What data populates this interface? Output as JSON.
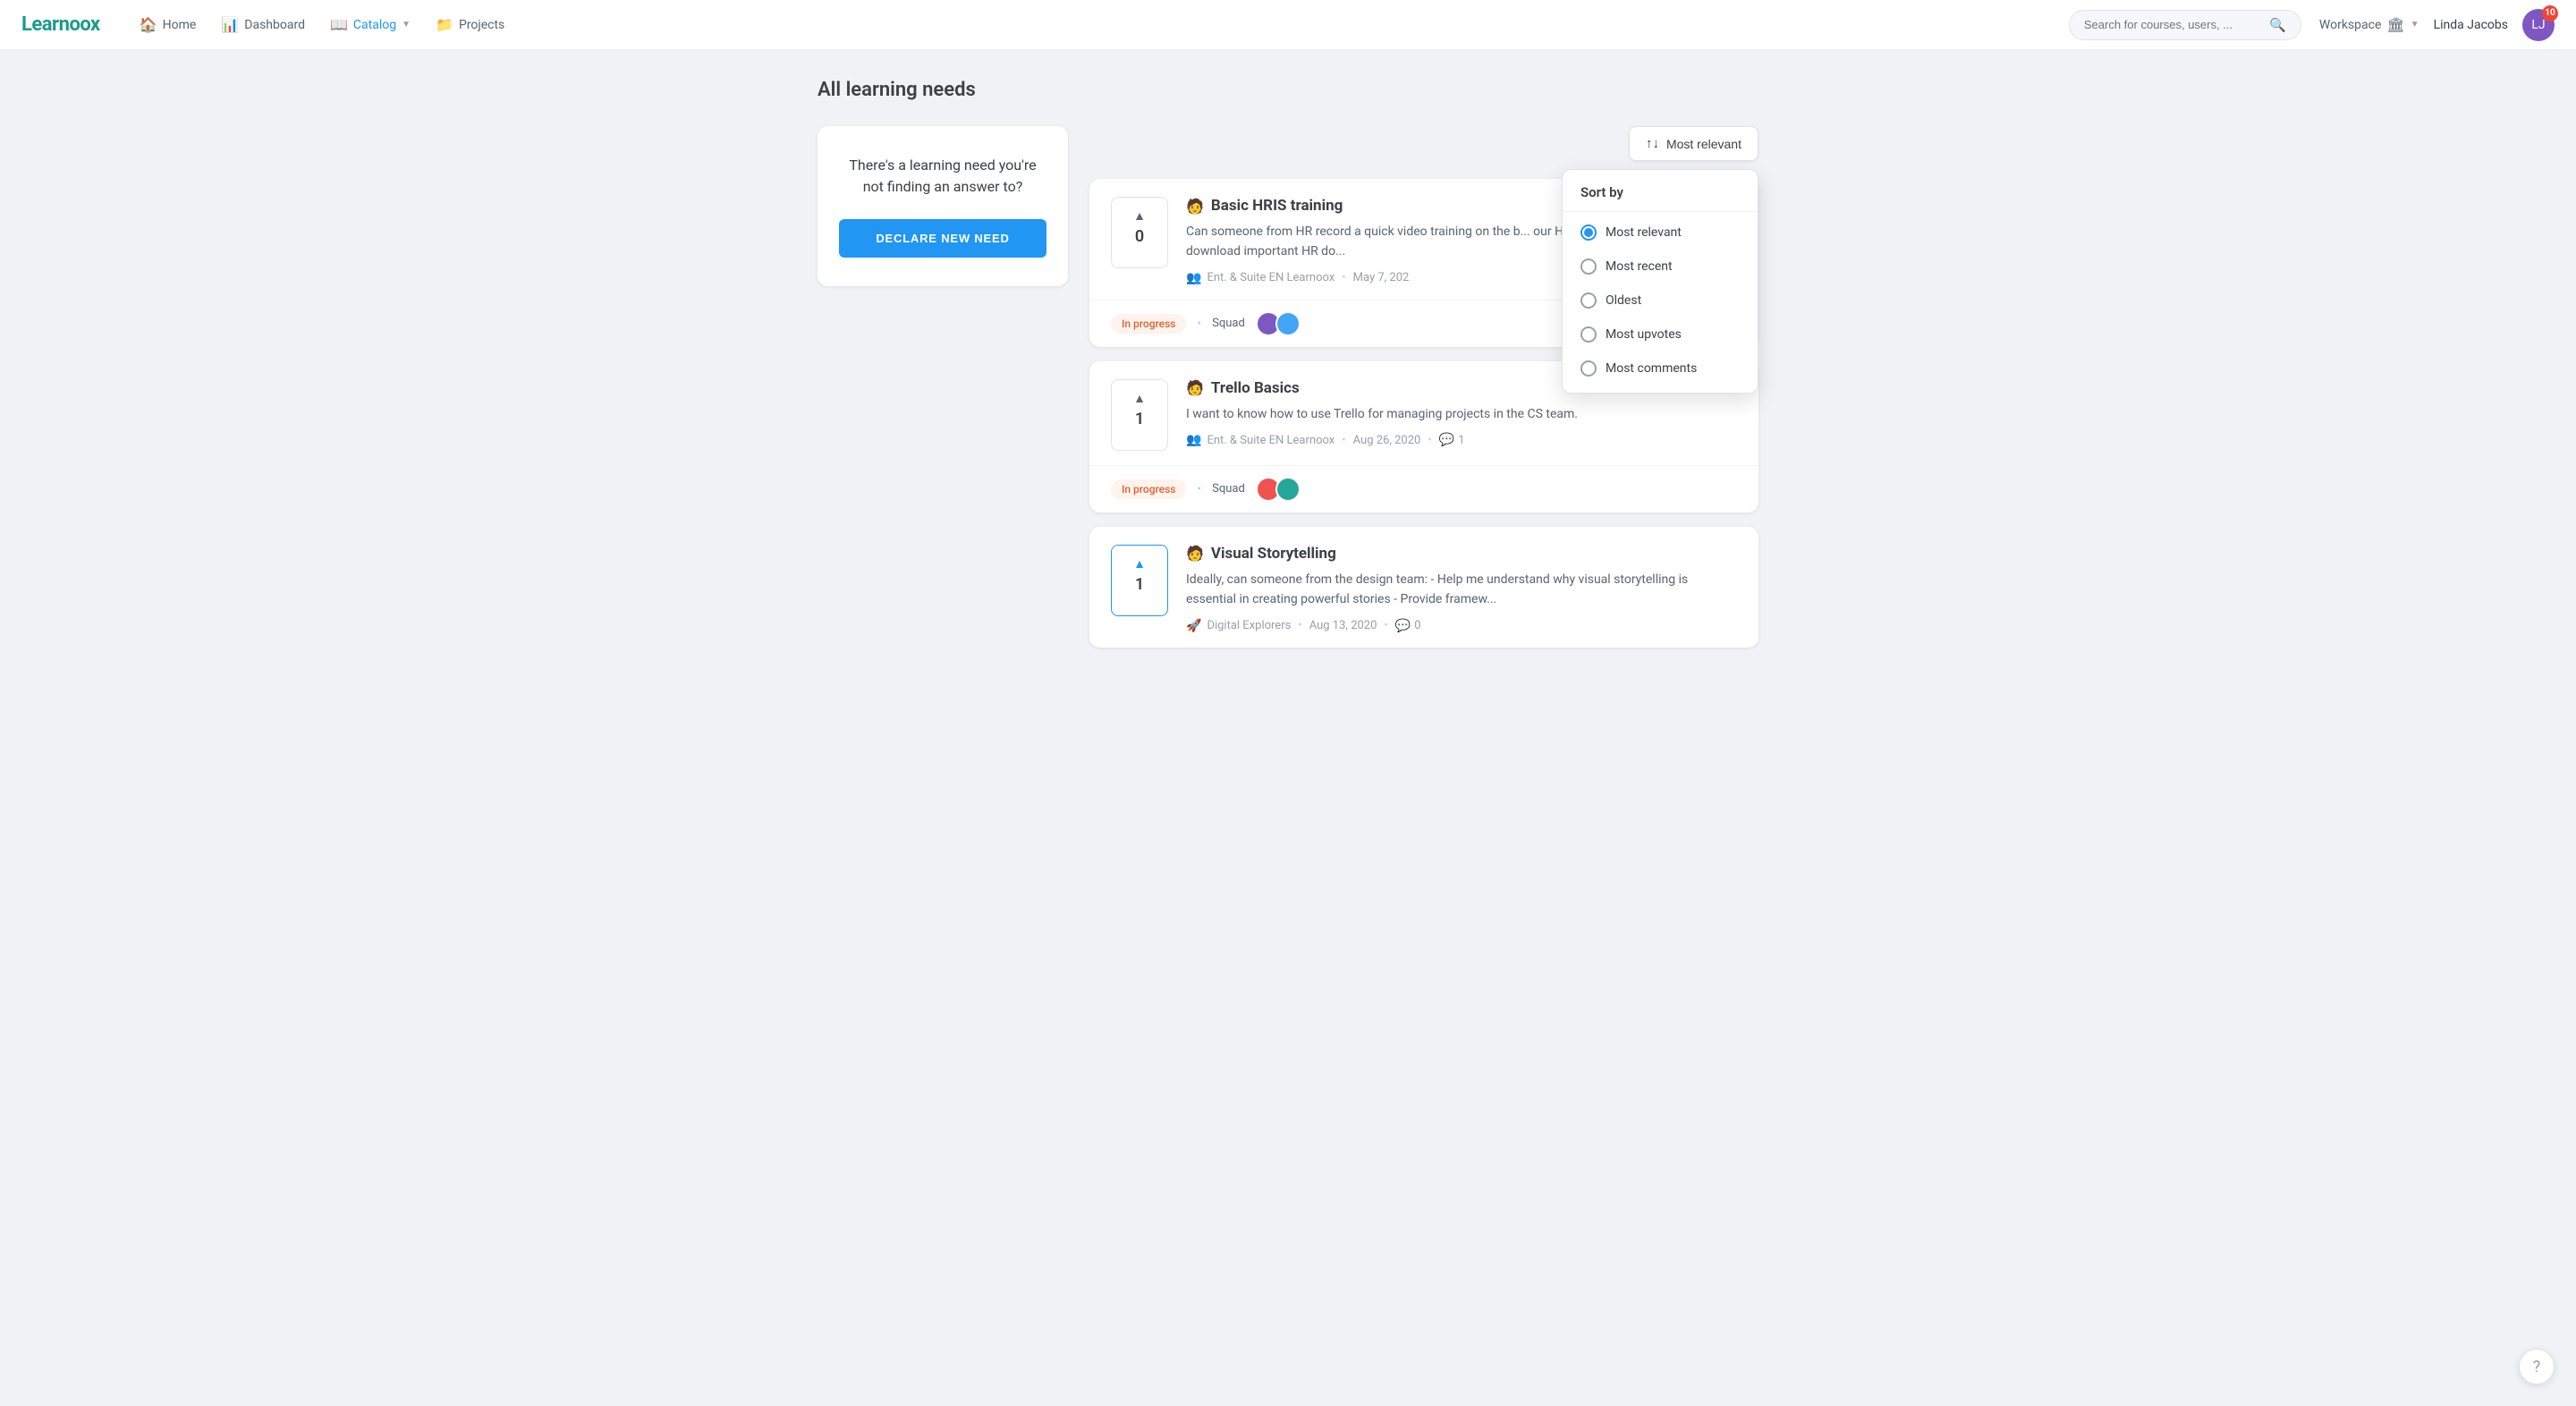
{
  "brand": {
    "logo": "Learnoox"
  },
  "nav": {
    "links": [
      {
        "id": "home",
        "icon": "🏠",
        "label": "Home",
        "active": false
      },
      {
        "id": "dashboard",
        "icon": "📊",
        "label": "Dashboard",
        "active": false
      },
      {
        "id": "catalog",
        "icon": "📖",
        "label": "Catalog",
        "active": true,
        "chevron": true
      },
      {
        "id": "projects",
        "icon": "📁",
        "label": "Projects",
        "active": false
      }
    ],
    "search_placeholder": "Search for courses, users, ...",
    "workspace_label": "Workspace",
    "user_name": "Linda Jacobs",
    "notification_count": "10"
  },
  "page": {
    "title": "All learning needs"
  },
  "sidebar": {
    "promo_text": "There's a learning need you're not finding an answer to?",
    "cta_label": "DECLARE NEW NEED"
  },
  "sort": {
    "button_label": "Most relevant",
    "dropdown_title": "Sort by",
    "options": [
      {
        "id": "most_relevant",
        "label": "Most relevant",
        "selected": true
      },
      {
        "id": "most_recent",
        "label": "Most recent",
        "selected": false
      },
      {
        "id": "oldest",
        "label": "Oldest",
        "selected": false
      },
      {
        "id": "most_upvotes",
        "label": "Most upvotes",
        "selected": false
      },
      {
        "id": "most_comments",
        "label": "Most comments",
        "selected": false
      }
    ]
  },
  "learning_needs": [
    {
      "id": "1",
      "vote_count": "0",
      "vote_selected": false,
      "avatar_emoji": "🧑",
      "title": "Basic HRIS training",
      "description": "Can someone from HR record a quick video training on the b... our HR tool? For instance, how to download important HR do...",
      "group_icon": "👥",
      "group_name": "Ent. & Suite EN Learnoox",
      "date": "May 7, 202",
      "has_comments": false,
      "comment_count": null,
      "status": "In progress",
      "squad_label": "Squad",
      "squad_avatars": [
        "av1",
        "av2"
      ]
    },
    {
      "id": "2",
      "vote_count": "1",
      "vote_selected": false,
      "avatar_emoji": "🧑",
      "title": "Trello Basics",
      "description": "I want to know how to use Trello for managing projects in the CS team.",
      "group_icon": "👥",
      "group_name": "Ent. & Suite EN Learnoox",
      "date": "Aug 26, 2020",
      "has_comments": true,
      "comment_count": "1",
      "status": "In progress",
      "squad_label": "Squad",
      "squad_avatars": [
        "av3",
        "av4"
      ]
    },
    {
      "id": "3",
      "vote_count": "1",
      "vote_selected": true,
      "avatar_emoji": "🧑",
      "title": "Visual Storytelling",
      "description": "Ideally, can someone from the design team: - Help me understand why visual storytelling is essential in creating powerful stories - Provide framew...",
      "group_icon": "🚀",
      "group_name": "Digital Explorers",
      "date": "Aug 13, 2020",
      "has_comments": true,
      "comment_count": "0",
      "status": null,
      "squad_label": null,
      "squad_avatars": []
    }
  ],
  "help": {
    "icon": "?"
  }
}
